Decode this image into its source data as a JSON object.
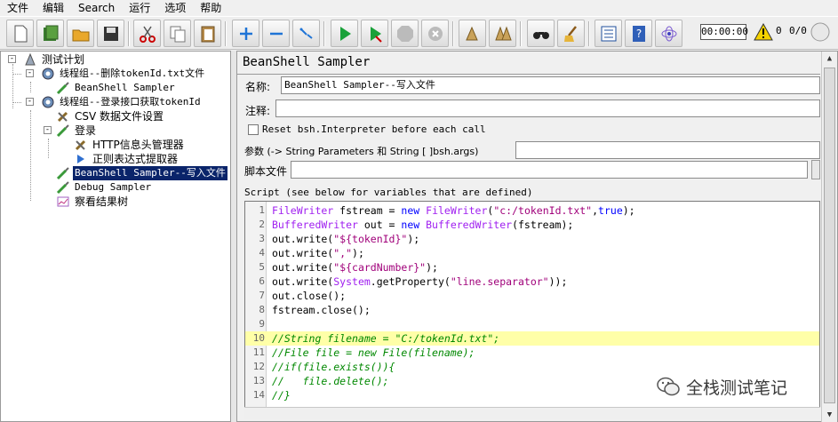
{
  "menu": [
    "文件",
    "编辑",
    "Search",
    "运行",
    "选项",
    "帮助"
  ],
  "toolbar": {
    "buttons": [
      "new-icon",
      "templates-icon",
      "open-icon",
      "save-icon",
      "cut-icon",
      "copy-icon",
      "paste-icon",
      "expand-icon",
      "collapse-icon",
      "toggle-icon",
      "start-icon",
      "start-no-pause-icon",
      "stop-icon",
      "shutdown-icon",
      "clear-icon",
      "clear-all-icon",
      "search-icon",
      "reset-search-icon",
      "function-helper-icon",
      "help-icon",
      "remote-icon"
    ],
    "timer": "00:00:00",
    "warning_count": "0",
    "threads": "0/0"
  },
  "tree": {
    "items": [
      {
        "label": "测试计划"
      },
      {
        "label": "线程组--删除tokenId.txt文件"
      },
      {
        "label": "BeanShell Sampler"
      },
      {
        "label": "线程组--登录接口获取tokenId"
      },
      {
        "label": "CSV 数据文件设置"
      },
      {
        "label": "登录"
      },
      {
        "label": "HTTP信息头管理器"
      },
      {
        "label": "正则表达式提取器"
      },
      {
        "label": "BeanShell Sampler--写入文件"
      },
      {
        "label": "Debug Sampler"
      },
      {
        "label": "察看结果树"
      }
    ]
  },
  "panel": {
    "title": "BeanShell Sampler",
    "name_label": "名称:",
    "name_value": "BeanShell Sampler--写入文件",
    "comment_label": "注释:",
    "comment_value": "",
    "reset_label": "Reset bsh.Interpreter before each call",
    "params_label": "参数 (-> String Parameters 和 String [ ]bsh.args)",
    "params_value": "",
    "script_file_label": "脚本文件",
    "script_file_value": "",
    "script_label": "Script (see below for variables that are defined)"
  },
  "script": {
    "lines": [
      {
        "n": "1",
        "parts": [
          [
            "t",
            "FileWriter"
          ],
          [
            "",
            " fstream = "
          ],
          [
            "k",
            "new"
          ],
          [
            "",
            " "
          ],
          [
            "t",
            "FileWriter"
          ],
          [
            "",
            "("
          ],
          [
            "s",
            "\"c:/tokenId.txt\""
          ],
          [
            "",
            ","
          ],
          [
            "k",
            "true"
          ],
          [
            "",
            ");"
          ]
        ]
      },
      {
        "n": "2",
        "parts": [
          [
            "t",
            "BufferedWriter"
          ],
          [
            "",
            " out = "
          ],
          [
            "k",
            "new"
          ],
          [
            "",
            " "
          ],
          [
            "t",
            "BufferedWriter"
          ],
          [
            "",
            "(fstream);"
          ]
        ]
      },
      {
        "n": "3",
        "parts": [
          [
            "",
            "out.write("
          ],
          [
            "s",
            "\"${tokenId}\""
          ],
          [
            "",
            ");"
          ]
        ]
      },
      {
        "n": "4",
        "parts": [
          [
            "",
            "out.write("
          ],
          [
            "s",
            "\",\""
          ],
          [
            "",
            ");"
          ]
        ]
      },
      {
        "n": "5",
        "parts": [
          [
            "",
            "out.write("
          ],
          [
            "s",
            "\"${cardNumber}\""
          ],
          [
            "",
            ");"
          ]
        ]
      },
      {
        "n": "6",
        "parts": [
          [
            "",
            "out.write("
          ],
          [
            "t",
            "System"
          ],
          [
            "",
            ".getProperty("
          ],
          [
            "s",
            "\"line.separator\""
          ],
          [
            "",
            "));"
          ]
        ]
      },
      {
        "n": "7",
        "parts": [
          [
            "",
            "out.close();"
          ]
        ]
      },
      {
        "n": "8",
        "parts": [
          [
            "",
            "fstream.close();"
          ]
        ]
      },
      {
        "n": "9",
        "parts": []
      },
      {
        "n": "10",
        "parts": [
          [
            "c",
            "//String filename = \"C:/tokenId.txt\";"
          ]
        ]
      },
      {
        "n": "11",
        "parts": [
          [
            "c",
            "//File file = new File(filename);"
          ]
        ]
      },
      {
        "n": "12",
        "parts": [
          [
            "c",
            "//if(file.exists()){"
          ]
        ]
      },
      {
        "n": "13",
        "parts": [
          [
            "c",
            "//   file.delete();"
          ]
        ]
      },
      {
        "n": "14",
        "parts": [
          [
            "c",
            "//}"
          ]
        ]
      }
    ],
    "highlighted_line": "10"
  },
  "watermark": "全栈测试笔记",
  "colors": {
    "selection": "#0a246a",
    "keyword": "#0000ff",
    "type": "#a020f0",
    "string": "#a0007a",
    "comment": "#008800",
    "highlight": "#ffffa8"
  }
}
